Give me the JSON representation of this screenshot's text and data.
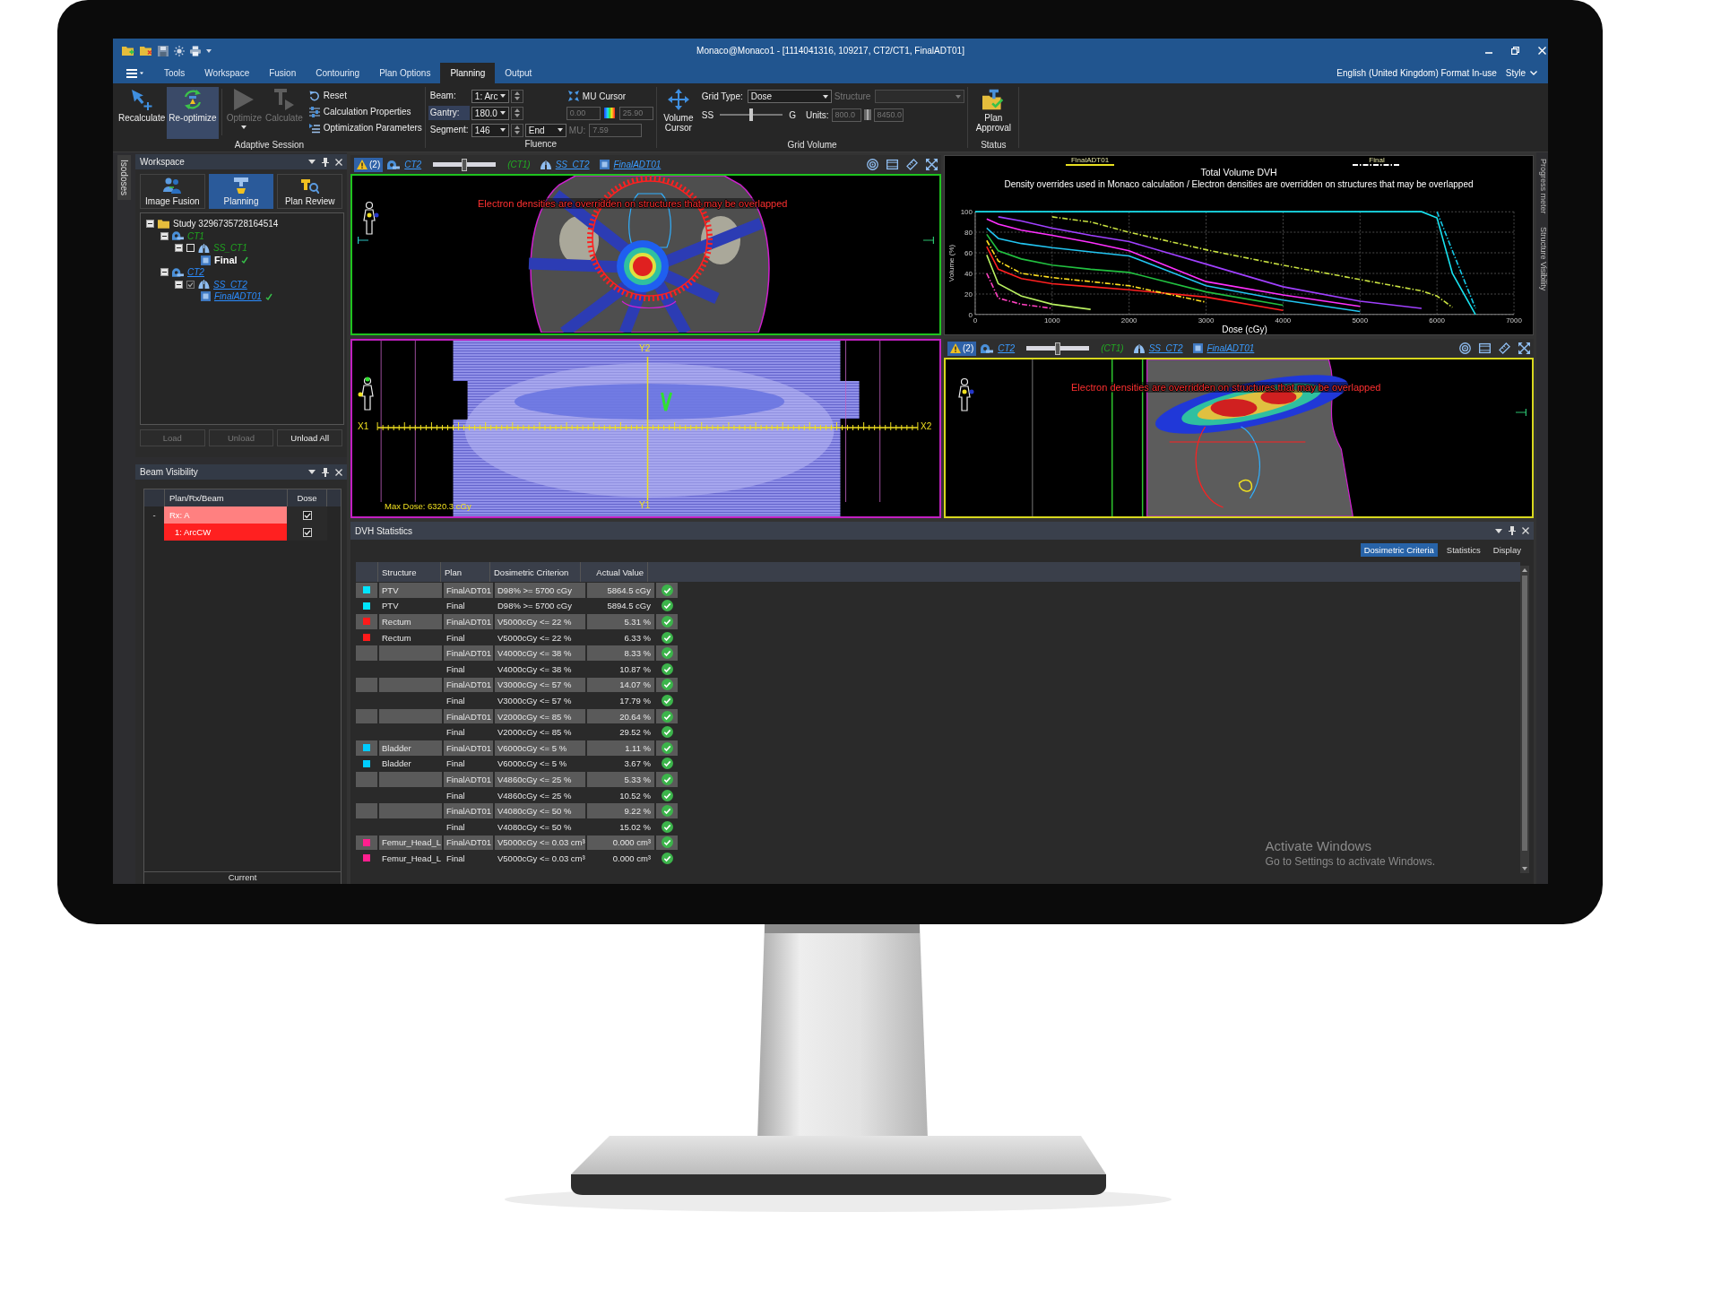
{
  "window": {
    "title": "Monaco@Monaco1 - [1114041316, 109217, CT2/CT1, FinalADT01]"
  },
  "menu": {
    "tabs": [
      {
        "label": "Tools",
        "selected": false
      },
      {
        "label": "Workspace",
        "selected": false
      },
      {
        "label": "Fusion",
        "selected": false
      },
      {
        "label": "Contouring",
        "selected": false
      },
      {
        "label": "Plan Options",
        "selected": false
      },
      {
        "label": "Planning",
        "selected": true
      },
      {
        "label": "Output",
        "selected": false
      }
    ],
    "locale": "English (United Kingdom) Format In-use",
    "style_menu": "Style"
  },
  "ribbon": {
    "adaptive_session": {
      "label": "Adaptive Session",
      "edit_buttons": [
        {
          "label": "Recalculate",
          "selected": false,
          "disabled": false
        },
        {
          "label": "Re-optimize",
          "selected": true,
          "disabled": false
        }
      ],
      "run_buttons": [
        {
          "label": "Optimize",
          "disabled": true,
          "has_menu": true
        },
        {
          "label": "Calculate",
          "disabled": true,
          "has_menu": false
        }
      ],
      "small_buttons": [
        "Reset",
        "Calculation Properties",
        "Optimization Parameters"
      ]
    },
    "fluence": {
      "label": "Fluence",
      "fields": [
        {
          "label": "Beam:",
          "value": "1: Arc",
          "highlighted": false
        },
        {
          "label": "Gantry:",
          "value": "180.0",
          "highlighted": true
        },
        {
          "label": "Segment:",
          "value": "146",
          "highlighted": false
        }
      ],
      "segment_mode": "End",
      "mu": {
        "label": "MU:",
        "value": "7.59",
        "disabled": true
      },
      "mu_cursor": {
        "label": "MU Cursor",
        "min": "0.00",
        "max": "25.90",
        "disabled": true
      }
    },
    "grid_volume": {
      "label": "Grid Volume",
      "cursor_button": "Volume Cursor",
      "grid_type": {
        "label": "Grid Type:",
        "value": "Dose"
      },
      "structure": {
        "label": "Structure",
        "disabled": true
      },
      "smoothing": {
        "left": "SS",
        "right": "G",
        "level": 0.5
      },
      "units": {
        "label": "Units:",
        "min": "800.0",
        "max": "8450.0",
        "disabled": true
      }
    },
    "status": {
      "label": "Status",
      "button": "Plan Approval"
    }
  },
  "side_tabs": {
    "left": "Isodoses",
    "right": [
      "Progress meter",
      "Structure Visibility"
    ]
  },
  "workspace": {
    "title": "Workspace",
    "modes": [
      {
        "label": "Image Fusion",
        "selected": false
      },
      {
        "label": "Planning",
        "selected": true
      },
      {
        "label": "Plan Review",
        "selected": false
      }
    ],
    "tree": [
      {
        "label": "Study 3296735728164514",
        "kind": "study",
        "expanded": true,
        "children": [
          {
            "label": "CT1",
            "kind": "image",
            "primary": false,
            "expanded": true,
            "children": [
              {
                "label": "SS_CT1",
                "kind": "structure_set",
                "primary": false,
                "checked": false,
                "expanded": true,
                "children": [
                  {
                    "label": "Final",
                    "kind": "plan",
                    "primary": false,
                    "approved": true
                  }
                ]
              }
            ]
          },
          {
            "label": "CT2",
            "kind": "image",
            "primary": true,
            "expanded": true,
            "children": [
              {
                "label": "SS_CT2",
                "kind": "structure_set",
                "primary": true,
                "checked": true,
                "expanded": true,
                "children": [
                  {
                    "label": "FinalADT01",
                    "kind": "plan",
                    "primary": true,
                    "approved": true
                  }
                ]
              }
            ]
          }
        ]
      }
    ],
    "buttons": [
      {
        "label": "Load",
        "disabled": true
      },
      {
        "label": "Unload",
        "disabled": true
      },
      {
        "label": "Unload All",
        "disabled": false
      }
    ]
  },
  "beam_visibility": {
    "title": "Beam Visibility",
    "columns": [
      "Plan/Rx/Beam",
      "Dose"
    ],
    "rows": [
      {
        "expander": "-",
        "label": "Rx: A",
        "kind": "rx",
        "dose_visible": true
      },
      {
        "label": "1: ArcCW",
        "kind": "beam",
        "dose_visible": true
      }
    ],
    "footer": "Current"
  },
  "viewers": [
    {
      "kind": "axial",
      "color": "#1ec31e",
      "toolbar": {
        "warnings": "(2)",
        "image": "CT2",
        "slider": {
          "level": 0.5
        },
        "secondary": "(CT1)",
        "structure_set": "SS_CT2",
        "plan": "FinalADT01"
      },
      "overlay": "Electron densities are overridden on structures that may be overlapped"
    },
    {
      "kind": "dvh",
      "legend": [
        {
          "label": "FinalADT01",
          "dashed": false,
          "color": "#e8e020"
        },
        {
          "label": "Final",
          "dashed": true,
          "color": "#ffffff"
        }
      ],
      "subtitle": "Density overrides used in Monaco calculation / Electron densities are overridden on structures that may be overlapped",
      "chart_data": {
        "type": "line",
        "title": "Total Volume DVH",
        "xlabel": "Dose (cGy)",
        "ylabel": "Volume (%)",
        "grid": true,
        "x": [
          0,
          150,
          300,
          600,
          1000,
          1500,
          2000,
          3000,
          4000,
          5000,
          5800,
          6000,
          6200,
          6500
        ],
        "xlim": [
          0,
          7000
        ],
        "ylim": [
          0,
          100
        ],
        "xticks": [
          0,
          1000,
          2000,
          3000,
          4000,
          5000,
          6000,
          7000
        ],
        "yticks": [
          0,
          20,
          40,
          60,
          80,
          100
        ],
        "series": [
          {
            "color": "#19e3f0",
            "line_style": "solid",
            "values": [
              100,
              100,
              100,
              100,
              100,
              100,
              100,
              100,
              100,
              100,
              100,
              94,
              40,
              0
            ]
          },
          {
            "color": "#14c8e6",
            "line_style": "dashdot",
            "values": [
              null,
              null,
              null,
              null,
              null,
              null,
              null,
              null,
              null,
              null,
              null,
              100,
              62,
              6
            ]
          },
          {
            "color": "#c8e040",
            "line_style": "dashdot",
            "values": [
              null,
              null,
              null,
              null,
              95,
              90,
              80,
              63,
              48,
              34,
              23,
              18,
              7,
              null
            ]
          },
          {
            "color": "#ff30ff",
            "line_style": "solid",
            "values": [
              null,
              93,
              88,
              82,
              77,
              70,
              62,
              32,
              19,
              8,
              null,
              null,
              null,
              null
            ]
          },
          {
            "color": "#a040ff",
            "line_style": "solid",
            "values": [
              null,
              null,
              95,
              91,
              84,
              77,
              71,
              49,
              27,
              13,
              6,
              null,
              null,
              null
            ]
          },
          {
            "color": "#22c4f0",
            "line_style": "solid",
            "values": [
              null,
              84,
              74,
              69,
              65,
              61,
              57,
              28,
              14,
              3,
              null,
              null,
              null,
              null
            ]
          },
          {
            "color": "#22c040",
            "line_style": "solid",
            "values": [
              null,
              78,
              62,
              54,
              48,
              44,
              41,
              22,
              9,
              null,
              null,
              null,
              null,
              null
            ]
          },
          {
            "color": "#ff2020",
            "line_style": "solid",
            "values": [
              null,
              66,
              44,
              35,
              30,
              27,
              24,
              17,
              4,
              null,
              null,
              null,
              null,
              null
            ]
          },
          {
            "color": "#ffe020",
            "line_style": "dashdot",
            "values": [
              null,
              72,
              52,
              40,
              36,
              32,
              28,
              12,
              null,
              null,
              null,
              null,
              null,
              null
            ]
          },
          {
            "color": "#b8f060",
            "line_style": "solid",
            "values": [
              null,
              58,
              30,
              18,
              10,
              5,
              null,
              null,
              null,
              null,
              null,
              null,
              null,
              null
            ]
          },
          {
            "color": "#ff40c0",
            "line_style": "dashdot",
            "values": [
              null,
              40,
              16,
              10,
              6,
              null,
              null,
              null,
              null,
              null,
              null,
              null,
              null,
              null
            ]
          }
        ]
      }
    },
    {
      "kind": "beams_eye",
      "color": "#c21fc2",
      "labels": {
        "top": "Y2",
        "bottom": "Y1",
        "left": "X1",
        "right": "X2"
      },
      "max_dose": "Max Dose: 6320.3 cGy"
    },
    {
      "kind": "sagittal",
      "color": "#d8d81e",
      "toolbar": {
        "warnings": "(2)",
        "image": "CT2",
        "slider": {
          "level": 0.5
        },
        "secondary": "(CT1)",
        "structure_set": "SS_CT2",
        "plan": "FinalADT01"
      },
      "overlay": "Electron densities are overridden on structures that may be overlapped"
    }
  ],
  "dvh_statistics": {
    "title": "DVH Statistics",
    "tabs": [
      {
        "label": "Dosimetric Criteria",
        "selected": true
      },
      {
        "label": "Statistics",
        "selected": false
      },
      {
        "label": "Display",
        "selected": false
      }
    ],
    "columns": [
      "Structure",
      "Plan",
      "Dosimetric Criterion",
      "Actual Value"
    ],
    "rows": [
      {
        "structure": "PTV",
        "color": "#00e5ff",
        "plan": "FinalADT01",
        "criterion": "D98% >= 5700 cGy",
        "value": "5864.5 cGy",
        "passed": true
      },
      {
        "structure": "PTV",
        "color": "#00e5ff",
        "plan": "Final",
        "criterion": "D98% >= 5700 cGy",
        "value": "5894.5 cGy",
        "passed": true
      },
      {
        "structure": "Rectum",
        "color": "#ff1a1a",
        "plan": "FinalADT01",
        "criterion": "V5000cGy <= 22 %",
        "value": "5.31 %",
        "passed": true
      },
      {
        "structure": "Rectum",
        "color": "#ff1a1a",
        "plan": "Final",
        "criterion": "V5000cGy <= 22 %",
        "value": "6.33 %",
        "passed": true
      },
      {
        "plan": "FinalADT01",
        "criterion": "V4000cGy <= 38 %",
        "value": "8.33 %",
        "passed": true
      },
      {
        "plan": "Final",
        "criterion": "V4000cGy <= 38 %",
        "value": "10.87 %",
        "passed": true
      },
      {
        "plan": "FinalADT01",
        "criterion": "V3000cGy <= 57 %",
        "value": "14.07 %",
        "passed": true
      },
      {
        "plan": "Final",
        "criterion": "V3000cGy <= 57 %",
        "value": "17.79 %",
        "passed": true
      },
      {
        "plan": "FinalADT01",
        "criterion": "V2000cGy <= 85 %",
        "value": "20.64 %",
        "passed": true
      },
      {
        "plan": "Final",
        "criterion": "V2000cGy <= 85 %",
        "value": "29.52 %",
        "passed": true
      },
      {
        "structure": "Bladder",
        "color": "#00ccff",
        "plan": "FinalADT01",
        "criterion": "V6000cGy <= 5 %",
        "value": "1.11 %",
        "passed": true
      },
      {
        "structure": "Bladder",
        "color": "#00ccff",
        "plan": "Final",
        "criterion": "V6000cGy <= 5 %",
        "value": "3.67 %",
        "passed": true
      },
      {
        "plan": "FinalADT01",
        "criterion": "V4860cGy <= 25 %",
        "value": "5.33 %",
        "passed": true
      },
      {
        "plan": "Final",
        "criterion": "V4860cGy <= 25 %",
        "value": "10.52 %",
        "passed": true
      },
      {
        "plan": "FinalADT01",
        "criterion": "V4080cGy <= 50 %",
        "value": "9.22 %",
        "passed": true
      },
      {
        "plan": "Final",
        "criterion": "V4080cGy <= 50 %",
        "value": "15.02 %",
        "passed": true
      },
      {
        "structure": "Femur_Head_L",
        "color": "#ff1f8f",
        "plan": "FinalADT01",
        "criterion": "V5000cGy <= 0.03 cm³",
        "value": "0.000 cm³",
        "passed": true
      },
      {
        "structure": "Femur_Head_L",
        "color": "#ff1f8f",
        "plan": "Final",
        "criterion": "V5000cGy <= 0.03 cm³",
        "value": "0.000 cm³",
        "passed": true
      }
    ]
  },
  "os_notice": {
    "title": "Activate Windows",
    "text": "Go to Settings to activate Windows."
  }
}
